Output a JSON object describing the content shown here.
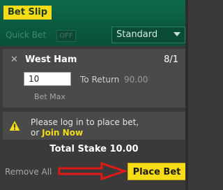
{
  "header": {
    "title": "Bet Slip"
  },
  "quick_bet": {
    "label": "Quick Bet",
    "toggle_state": "OFF"
  },
  "bet_type_select": {
    "value": "Standard"
  },
  "bet": {
    "remove_icon": "✕",
    "selection": "West Ham",
    "odds": "8/1",
    "stake": "10",
    "to_return_label": "To Return",
    "to_return_value": "90.00",
    "bet_max_label": "Bet Max"
  },
  "notice": {
    "icon": "warning-icon",
    "line1": "Please log in to place bet,",
    "line2_prefix": "or",
    "join_label": "Join Now"
  },
  "total_stake": "Total Stake 10.00",
  "footer": {
    "remove_all": "Remove All",
    "place_bet": "Place Bet"
  },
  "colors": {
    "brand_green": "#0a5a40",
    "accent_yellow": "#f5dc17",
    "arrow_red": "#e01818"
  }
}
